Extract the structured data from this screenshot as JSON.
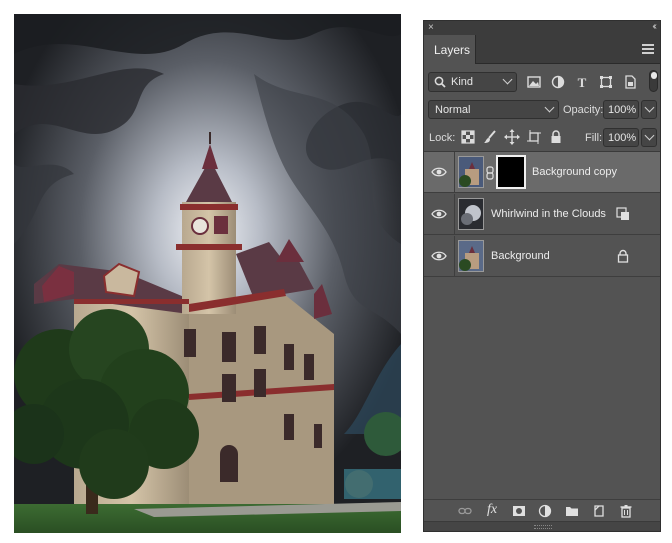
{
  "photo": {
    "alt_subject": "courthouse-under-storm-clouds"
  },
  "panel": {
    "tab_label": "Layers",
    "close_glyph": "×",
    "collapse_glyph": "‹‹",
    "filter": {
      "kind_label": "Kind",
      "icons": [
        "pixel-filter-icon",
        "adjustment-filter-icon",
        "type-filter-icon",
        "shape-filter-icon",
        "smart-object-filter-icon"
      ]
    },
    "blend_mode": "Normal",
    "opacity_label": "Opacity:",
    "opacity_value": "100%",
    "lock_label": "Lock:",
    "fill_label": "Fill:",
    "fill_value": "100%",
    "layers": [
      {
        "name": "Background copy",
        "selected": true,
        "has_mask": true,
        "badge": "",
        "visible": true
      },
      {
        "name": "Whirlwind in the Clouds",
        "selected": false,
        "has_mask": false,
        "badge": "smart-object-icon",
        "visible": true
      },
      {
        "name": "Background",
        "selected": false,
        "has_mask": false,
        "badge": "lock-icon",
        "visible": true
      }
    ],
    "footer_icons": [
      "link-layers-icon",
      "fx-icon",
      "add-mask-icon",
      "adjustment-layer-icon",
      "new-group-icon",
      "new-layer-icon",
      "trash-icon"
    ],
    "fx_text": "fx"
  },
  "colors": {
    "panel_bg": "#535353",
    "selected_row": "#6a6a6a",
    "roof_red": "#8a2e2e",
    "stone": "#c9b89e"
  }
}
